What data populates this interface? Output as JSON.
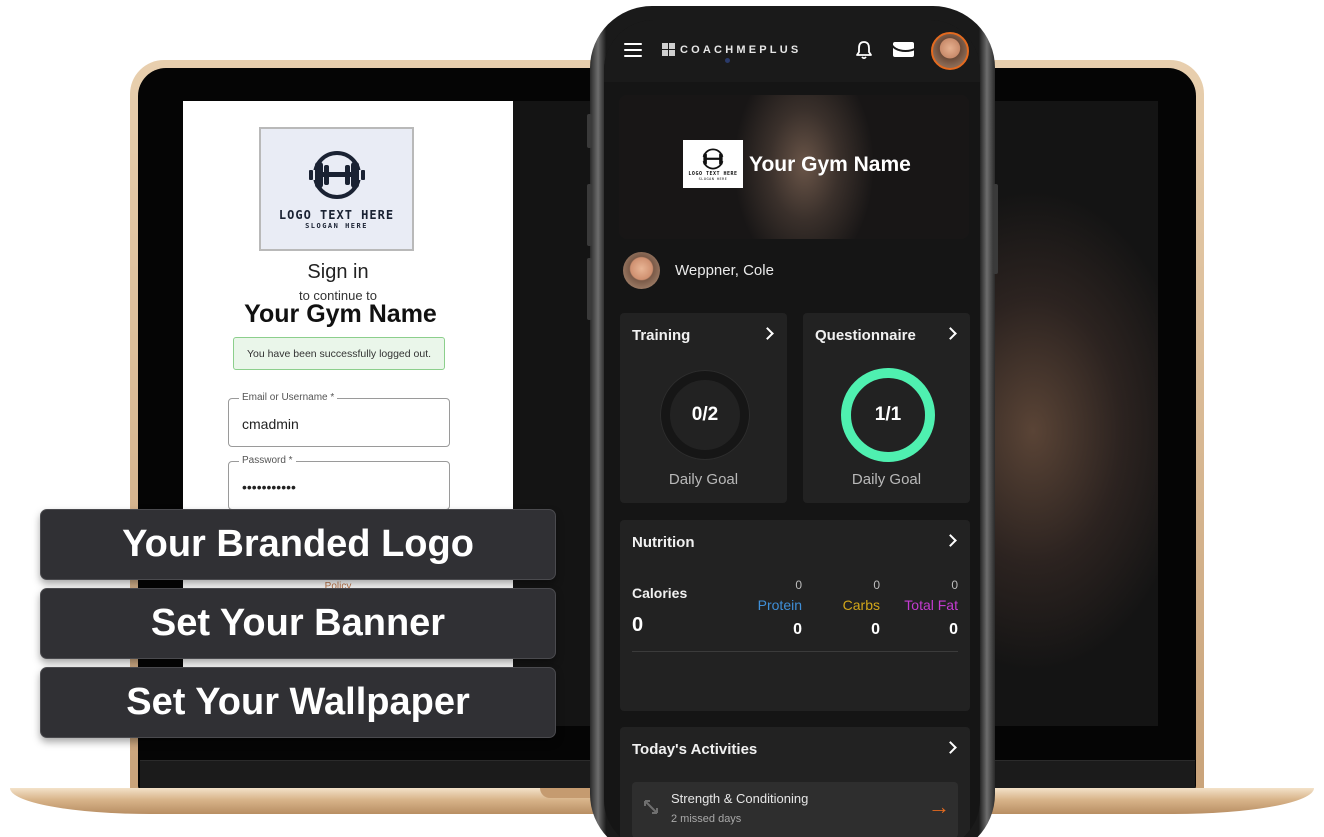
{
  "signin": {
    "logo_text": "LOGO TEXT HERE",
    "logo_slogan": "SLOGAN HERE",
    "title": "Sign in",
    "subtitle": "to continue to",
    "gym_name": "Your Gym Name",
    "logout_message": "You have been successfully logged out.",
    "email_label": "Email or Username *",
    "email_value": "cmadmin",
    "password_label": "Password *",
    "password_value": "•••••••••••",
    "policy_text": "Policy"
  },
  "callouts": [
    "Your Branded Logo",
    "Set Your Banner",
    "Set Your Wallpaper"
  ],
  "app": {
    "brand": "COACHMEPLUS",
    "banner": {
      "logo_text": "LOGO TEXT HERE",
      "logo_slogan": "SLOGAN HERE",
      "title": "Your Gym Name"
    },
    "user": {
      "name": "Weppner, Cole"
    },
    "training": {
      "title": "Training",
      "value": "0/2",
      "label": "Daily Goal",
      "progress": 0
    },
    "questionnaire": {
      "title": "Questionnaire",
      "value": "1/1",
      "label": "Daily Goal",
      "progress": 1
    },
    "nutrition": {
      "title": "Nutrition",
      "calories_label": "Calories",
      "calories_value": "0",
      "macros": [
        {
          "name": "Protein",
          "target": "0",
          "value": "0",
          "color": "#3f8fd8"
        },
        {
          "name": "Carbs",
          "target": "0",
          "value": "0",
          "color": "#d2a61a"
        },
        {
          "name": "Total Fat",
          "target": "0",
          "value": "0",
          "color": "#c43bd1"
        }
      ]
    },
    "activities": {
      "title": "Today's Activities",
      "items": [
        {
          "title": "Strength & Conditioning",
          "subtitle": "2 missed days"
        }
      ]
    }
  },
  "colors": {
    "accent": "#e46a1f",
    "ring_complete": "#4ff0b0",
    "ring_track": "#1e1e1e"
  }
}
